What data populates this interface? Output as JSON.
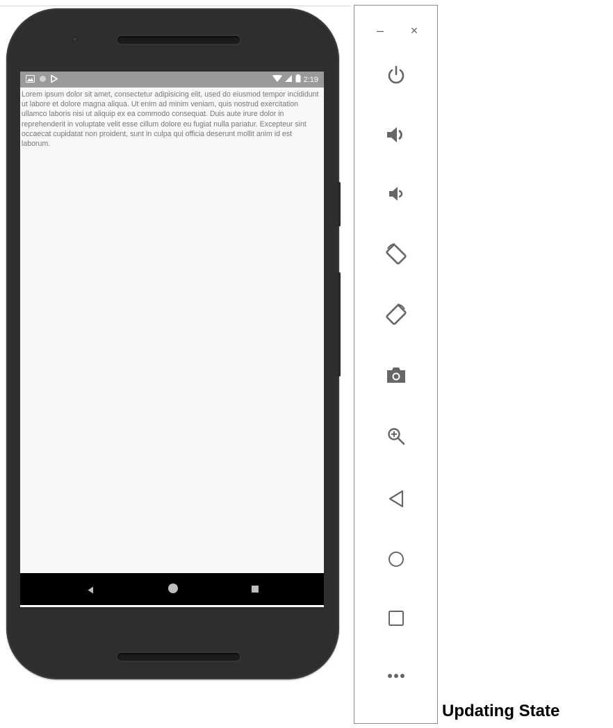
{
  "status_bar": {
    "time": "2:19",
    "left_icons": [
      "image-icon",
      "circle-icon",
      "play-store-icon"
    ],
    "right_icons": [
      "wifi-icon",
      "signal-icon",
      "battery-icon"
    ]
  },
  "content": {
    "text": "Lorem ipsum dolor sit amet, consectetur adipisicing elit, used do eiusmod tempor incididunt ut labore et dolore magna aliqua. Ut enim ad minim veniam, quis nostrud  exercitation ullamco laboris nisi ut aliquip ex ea commodo consequat. Duis aute irure dolor in reprehenderit in voluptate velit esse cillum dolore eu fugiat nulla pariatur. Excepteur sint occaecat cupidatat non proident, sunt in culpa qui officia deserunt mollit anim id est laborum."
  },
  "nav_bar": {
    "buttons": [
      "back-icon",
      "home-icon",
      "recents-icon"
    ]
  },
  "toolbar": {
    "minimize_label": "–",
    "close_label": "×",
    "tools": [
      "power",
      "volume-up",
      "volume-down",
      "rotate-left",
      "rotate-right",
      "screenshot",
      "zoom",
      "back",
      "home",
      "overview",
      "more"
    ],
    "more_label": "•••"
  },
  "caption": "Updating State",
  "colors": {
    "phone_body": "#2e2e2e",
    "status_bar": "#9a9a9a",
    "icon_gray": "#666666",
    "text_gray": "#777777"
  }
}
